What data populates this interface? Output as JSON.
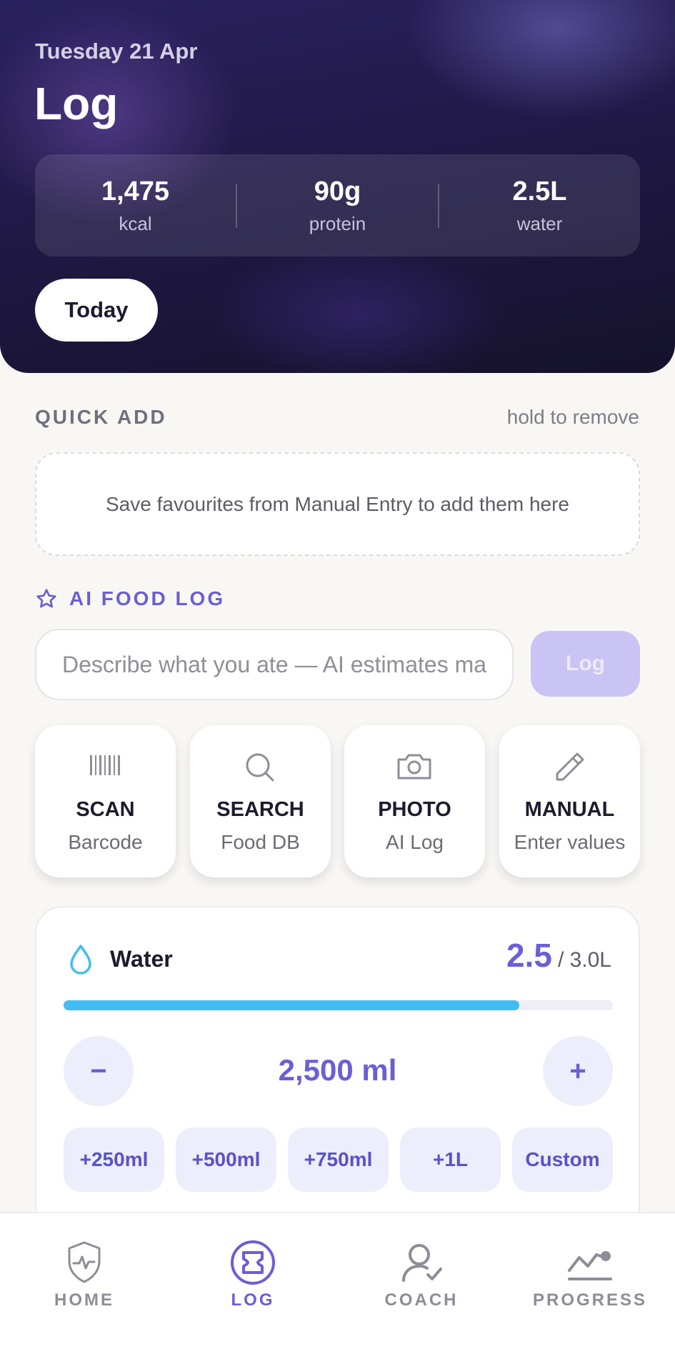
{
  "header": {
    "date": "Tuesday 21 Apr",
    "title": "Log",
    "today_label": "Today",
    "stats": [
      {
        "value": "1,475",
        "label": "kcal"
      },
      {
        "value": "90g",
        "label": "protein"
      },
      {
        "value": "2.5L",
        "label": "water"
      }
    ]
  },
  "quick_add": {
    "title": "QUICK ADD",
    "hint": "hold to remove",
    "empty_text": "Save favourites from Manual Entry to add them here"
  },
  "ai_log": {
    "title": "AI FOOD LOG",
    "icon": "star-icon",
    "placeholder": "Describe what you ate — AI estimates macros",
    "button_label": "Log"
  },
  "actions": [
    {
      "title": "SCAN",
      "subtitle": "Barcode",
      "icon": "barcode-icon"
    },
    {
      "title": "SEARCH",
      "subtitle": "Food DB",
      "icon": "search-icon"
    },
    {
      "title": "PHOTO",
      "subtitle": "AI Log",
      "icon": "camera-icon"
    },
    {
      "title": "MANUAL",
      "subtitle": "Enter values",
      "icon": "pencil-icon"
    }
  ],
  "water": {
    "label": "Water",
    "current": "2.5",
    "goal": "/ 3.0L",
    "progress": 0.83,
    "amount_display": "2,500 ml",
    "decrement": "−",
    "increment": "+",
    "chips": [
      "+250ml",
      "+500ml",
      "+750ml",
      "+1L",
      "Custom"
    ]
  },
  "nav": [
    {
      "label": "HOME",
      "icon": "shield-heartbeat-icon",
      "active": false
    },
    {
      "label": "LOG",
      "icon": "log-circle-icon",
      "active": true
    },
    {
      "label": "COACH",
      "icon": "coach-icon",
      "active": false
    },
    {
      "label": "PROGRESS",
      "icon": "chart-icon",
      "active": false
    }
  ],
  "colors": {
    "accent": "#6a5fd6",
    "water": "#41bdf4",
    "background": "#f8f7f4"
  }
}
